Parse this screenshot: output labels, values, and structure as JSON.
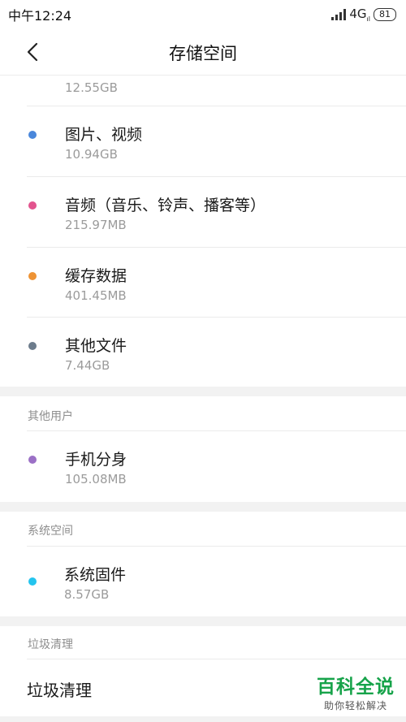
{
  "status": {
    "time": "中午12:24",
    "network": "4G",
    "battery": "81"
  },
  "header": {
    "title": "存储空间"
  },
  "apps_partial": {
    "size": "12.55GB"
  },
  "items": [
    {
      "name": "图片、视频",
      "size": "10.94GB",
      "color": "#4a87db"
    },
    {
      "name": "音频（音乐、铃声、播客等）",
      "size": "215.97MB",
      "color": "#e2548e"
    },
    {
      "name": "缓存数据",
      "size": "401.45MB",
      "color": "#ee9334"
    },
    {
      "name": "其他文件",
      "size": "7.44GB",
      "color": "#6d7c8c"
    }
  ],
  "other_users": {
    "header": "其他用户",
    "item": {
      "name": "手机分身",
      "size": "105.08MB",
      "color": "#9b70c6"
    }
  },
  "system_space": {
    "header": "系统空间",
    "item": {
      "name": "系统固件",
      "size": "8.57GB",
      "color": "#24c4ee"
    }
  },
  "junk": {
    "header": "垃圾清理",
    "item": "垃圾清理"
  },
  "watermark": {
    "main": "百科全说",
    "sub": "助你轻松解决"
  }
}
